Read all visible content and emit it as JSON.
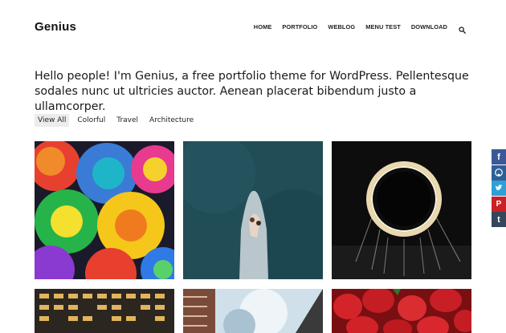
{
  "header": {
    "logo": "Genius",
    "nav": [
      {
        "label": "HOME"
      },
      {
        "label": "PORTFOLIO"
      },
      {
        "label": "WEBLOG"
      },
      {
        "label": "MENU TEST"
      },
      {
        "label": "DOWNLOAD"
      }
    ],
    "search_icon": "search-icon"
  },
  "intro": {
    "text": "Hello people! I'm Genius, a free portfolio theme for WordPress. Pellentesque sodales nunc ut ultricies auctor. Aenean placerat bibendum justo a ullamcorper."
  },
  "filters": [
    {
      "label": "View All",
      "active": true
    },
    {
      "label": "Colorful",
      "active": false
    },
    {
      "label": "Travel",
      "active": false
    },
    {
      "label": "Architecture",
      "active": false
    }
  ],
  "portfolio": {
    "items": [
      {
        "subject": "rainbow roses"
      },
      {
        "subject": "couple on rock at sea"
      },
      {
        "subject": "light painting circle"
      },
      {
        "subject": "lit building facade"
      },
      {
        "subject": "buildings and sky"
      },
      {
        "subject": "strawberries"
      }
    ]
  },
  "social": [
    {
      "icon": "facebook-icon",
      "glyph": "f",
      "color": "#3b5998"
    },
    {
      "icon": "github-icon",
      "glyph": "",
      "color": "#2d5f97"
    },
    {
      "icon": "twitter-icon",
      "glyph": "",
      "color": "#2fa0d6"
    },
    {
      "icon": "pinterest-icon",
      "glyph": "P",
      "color": "#cb2027"
    },
    {
      "icon": "tumblr-icon",
      "glyph": "t",
      "color": "#35465c"
    }
  ]
}
